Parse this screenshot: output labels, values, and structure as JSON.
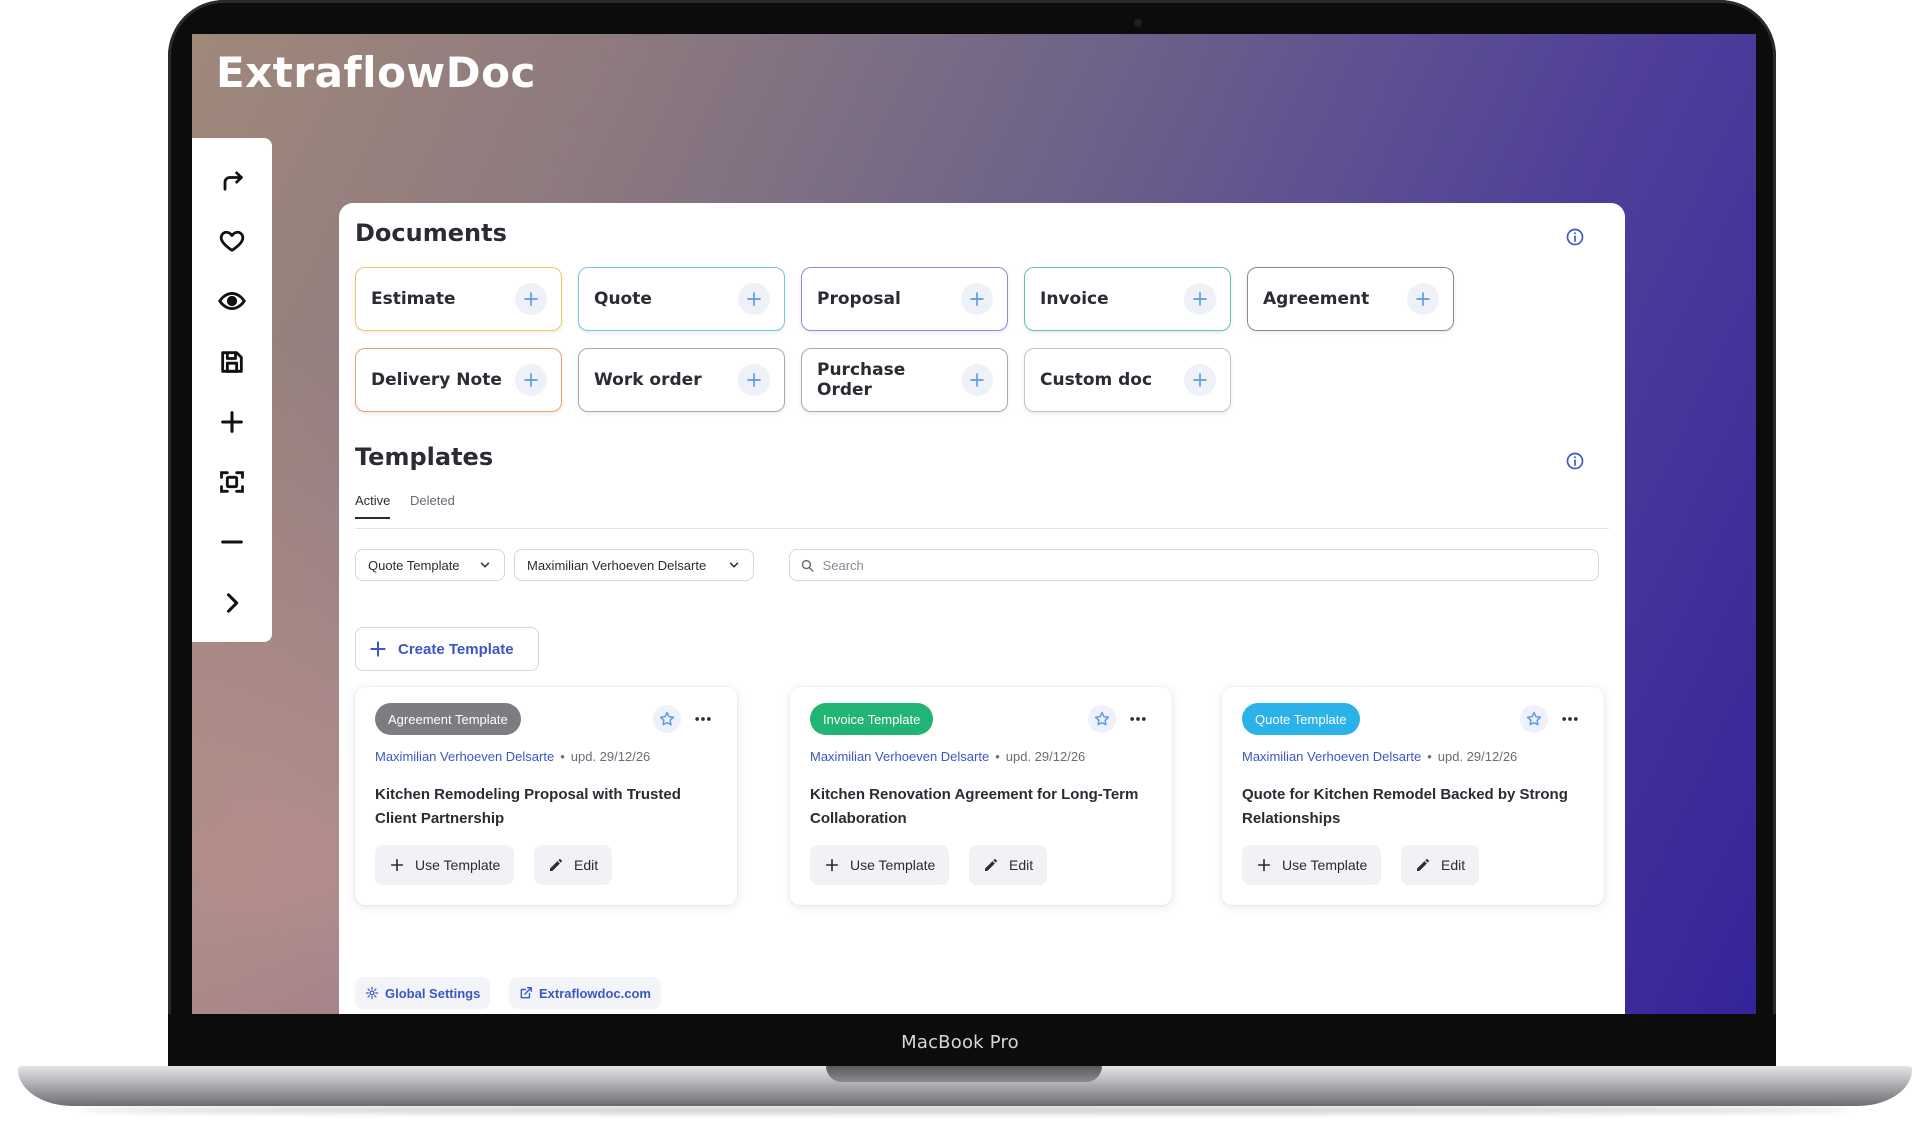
{
  "app": {
    "brand": "ExtraflowDoc"
  },
  "device": {
    "model": "MacBook Pro"
  },
  "toolbar": {
    "items": [
      {
        "icon": "redo-arrow-icon"
      },
      {
        "icon": "heart-icon"
      },
      {
        "icon": "eye-icon"
      },
      {
        "icon": "save-icon"
      },
      {
        "icon": "plus-icon"
      },
      {
        "icon": "focus-frame-icon"
      },
      {
        "icon": "minus-icon"
      },
      {
        "icon": "chevron-right-icon"
      }
    ]
  },
  "documents": {
    "title": "Documents",
    "items": [
      {
        "label": "Estimate",
        "color": "#f2c766"
      },
      {
        "label": "Quote",
        "color": "#6fc7ea"
      },
      {
        "label": "Proposal",
        "color": "#9d84d6"
      },
      {
        "label": "Invoice",
        "color": "#5fc79a"
      },
      {
        "label": "Agreement",
        "color": "#8a8a94"
      },
      {
        "label": "Delivery Note",
        "color": "#eda06b"
      },
      {
        "label": "Work order",
        "color": "#a9a9b2"
      },
      {
        "label": "Purchase Order",
        "color": "#a9a9b2"
      },
      {
        "label": "Custom doc",
        "color": "#c3c3ca"
      }
    ]
  },
  "templates": {
    "title": "Templates",
    "tabs": {
      "active": "Active",
      "deleted": "Deleted"
    },
    "filters": {
      "type": "Quote Template",
      "owner": "Maximilian Verhoeven Delsarte"
    },
    "search": {
      "placeholder": "Search"
    },
    "create_label": "Create Template",
    "cards": [
      {
        "badge": "Agreement Template",
        "badge_color": "#7c7c83",
        "author": "Maximilian Verhoeven Delsarte",
        "updated": "upd. 29/12/26",
        "title": "Kitchen Remodeling Proposal with Trusted Client Partnership",
        "use_label": "Use Template",
        "edit_label": "Edit"
      },
      {
        "badge": "Invoice Template",
        "badge_color": "#22b473",
        "author": "Maximilian Verhoeven Delsarte",
        "updated": "upd. 29/12/26",
        "title": "Kitchen Renovation Agreement for Long-Term Collaboration",
        "use_label": "Use Template",
        "edit_label": "Edit"
      },
      {
        "badge": "Quote Template",
        "badge_color": "#2bb2e8",
        "author": "Maximilian Verhoeven Delsarte",
        "updated": "upd. 29/12/26",
        "title": "Quote for Kitchen Remodel Backed by Strong Relationships",
        "use_label": "Use Template",
        "edit_label": "Edit"
      }
    ]
  },
  "footer": {
    "settings_label": "Global Settings",
    "site_label": "Extraflowdoc.com"
  }
}
